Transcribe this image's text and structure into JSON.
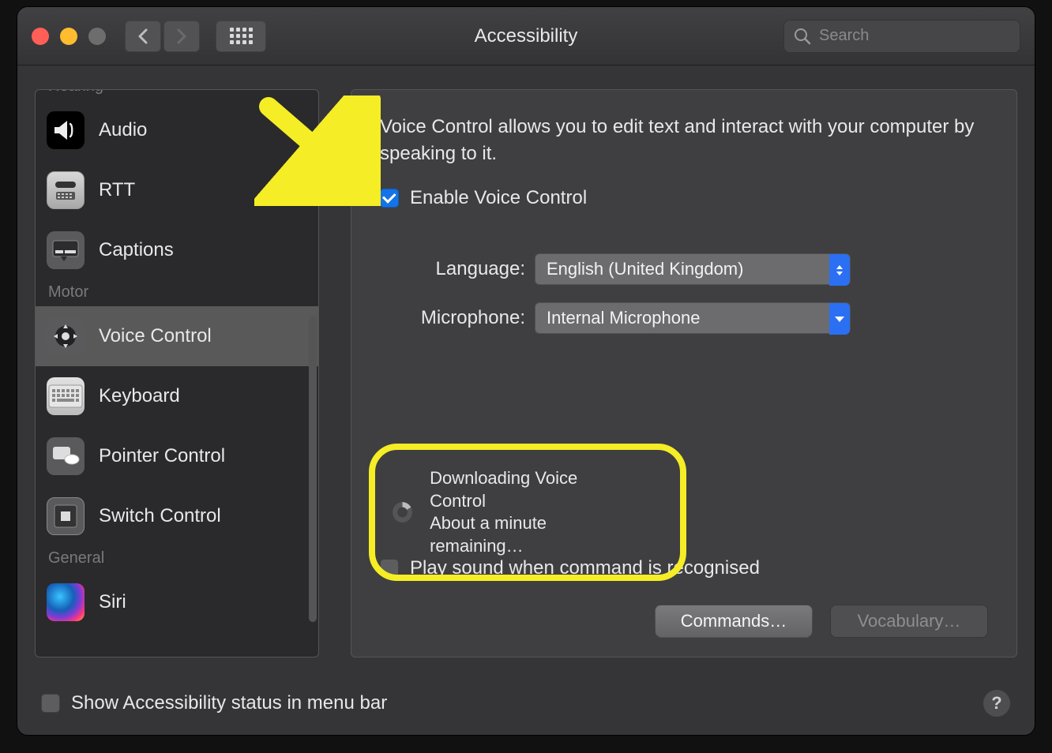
{
  "window": {
    "title": "Accessibility"
  },
  "toolbar": {
    "back_disabled": false,
    "forward_disabled": true,
    "search_placeholder": "Search"
  },
  "sidebar": {
    "sections": {
      "hearing": {
        "header": "Hearing",
        "items": [
          {
            "key": "audio",
            "label": "Audio"
          },
          {
            "key": "rtt",
            "label": "RTT"
          },
          {
            "key": "captions",
            "label": "Captions"
          }
        ]
      },
      "motor": {
        "header": "Motor",
        "items": [
          {
            "key": "voice-control",
            "label": "Voice Control",
            "selected": true
          },
          {
            "key": "keyboard",
            "label": "Keyboard"
          },
          {
            "key": "pointer-control",
            "label": "Pointer Control"
          },
          {
            "key": "switch-control",
            "label": "Switch Control"
          }
        ]
      },
      "general": {
        "header": "General",
        "items": [
          {
            "key": "siri",
            "label": "Siri"
          }
        ]
      }
    }
  },
  "main": {
    "description": "Voice Control allows you to edit text and interact with your computer by speaking to it.",
    "enable_label": "Enable Voice Control",
    "enable_checked": true,
    "language_label": "Language:",
    "language_value": "English (United Kingdom)",
    "microphone_label": "Microphone:",
    "microphone_value": "Internal Microphone",
    "download": {
      "line1": "Downloading Voice Control",
      "line2": "About a minute remaining…"
    },
    "play_sound_label": "Play sound when command is recognised",
    "play_sound_checked": false,
    "commands_button": "Commands…",
    "vocabulary_button": "Vocabulary…"
  },
  "footer": {
    "menubar_label": "Show Accessibility status in menu bar",
    "menubar_checked": false
  },
  "annotations": {
    "arrow_target": "enable-voice-control-checkbox",
    "highlight_target": "download-status"
  }
}
